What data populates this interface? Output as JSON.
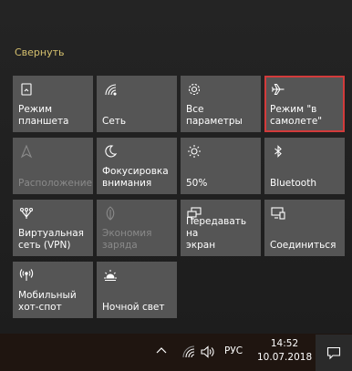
{
  "action_center": {
    "collapse_label": "Свернуть",
    "tiles": [
      {
        "label": "Режим\nпланшета",
        "icon": "tablet-mode-icon",
        "enabled": true
      },
      {
        "label": "Сеть",
        "icon": "network-icon",
        "enabled": true
      },
      {
        "label": "Все параметры",
        "icon": "settings-gear-icon",
        "enabled": true
      },
      {
        "label": "Режим \"в\nсамолете\"",
        "icon": "airplane-icon",
        "enabled": true,
        "selected": true
      },
      {
        "label": "Расположение",
        "icon": "location-icon",
        "enabled": false
      },
      {
        "label": "Фокусировка\nвнимания",
        "icon": "moon-icon",
        "enabled": true
      },
      {
        "label": "50%",
        "icon": "brightness-icon",
        "enabled": true
      },
      {
        "label": "Bluetooth",
        "icon": "bluetooth-icon",
        "enabled": true
      },
      {
        "label": "Виртуальная\nсеть (VPN)",
        "icon": "vpn-icon",
        "enabled": true
      },
      {
        "label": "Экономия\nзаряда",
        "icon": "battery-saver-icon",
        "enabled": false
      },
      {
        "label": "Передавать на\nэкран",
        "icon": "project-icon",
        "enabled": true
      },
      {
        "label": "Соединиться",
        "icon": "connect-icon",
        "enabled": true
      },
      {
        "label": "Мобильный\nхот-спот",
        "icon": "hotspot-icon",
        "enabled": true
      },
      {
        "label": "Ночной свет",
        "icon": "night-light-icon",
        "enabled": true
      }
    ]
  },
  "taskbar": {
    "language": "РУС",
    "time": "14:52",
    "date": "10.07.2018",
    "icons": [
      "chevron-up-icon",
      "wifi-icon",
      "volume-icon",
      "notifications-icon"
    ]
  },
  "colors": {
    "tile_background": "#555555",
    "selected_outline": "#d23b3b",
    "collapse_link": "#d6c16e",
    "disabled_text": "#8a8a8a"
  }
}
